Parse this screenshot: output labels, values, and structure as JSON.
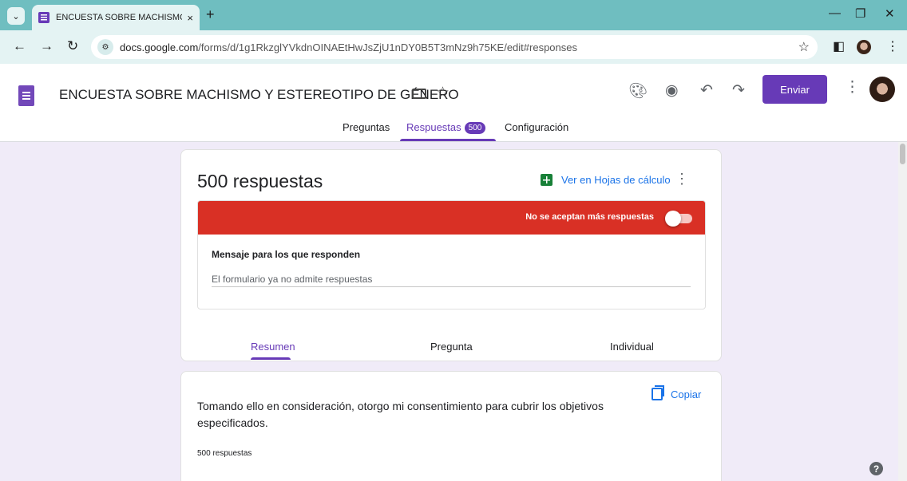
{
  "browser": {
    "tab_title": "ENCUESTA SOBRE MACHISMO",
    "tab_close": "×",
    "new_tab": "+",
    "url_domain": "docs.google.com",
    "url_path": "/forms/d/1g1RkzglYVkdnOINAEtHwJsZjU1nDY0B5T3mNz9h75KE/edit#responses"
  },
  "header": {
    "title": "ENCUESTA SOBRE MACHISMO Y ESTEREOTIPO DE GÉNERO",
    "send_label": "Enviar"
  },
  "nav_tabs": {
    "questions": "Preguntas",
    "responses": "Respuestas",
    "responses_count": "500",
    "settings": "Configuración"
  },
  "summary_card": {
    "response_count_label": "500 respuestas",
    "sheets_link": "Ver en Hojas de cálculo",
    "closed_notice": "No se aceptan más respuestas",
    "accepting_responses": false,
    "message_label": "Mensaje para los que responden",
    "message_value": "El formulario ya no admite respuestas",
    "sub_tabs": [
      "Resumen",
      "Pregunta",
      "Individual"
    ],
    "active_sub_tab": "Resumen"
  },
  "question_card": {
    "copy_label": "Copiar",
    "question_text": "Tomando ello en consideración, otorgo mi consentimiento para cubrir los objetivos especificados.",
    "response_count": "500 respuestas"
  },
  "help_glyph": "?",
  "colors": {
    "accent": "#673ab7",
    "notice_red": "#d93025",
    "link_blue": "#1a73e8",
    "page_bg": "#f0ebf8",
    "browser_frame": "#6fbec0"
  }
}
